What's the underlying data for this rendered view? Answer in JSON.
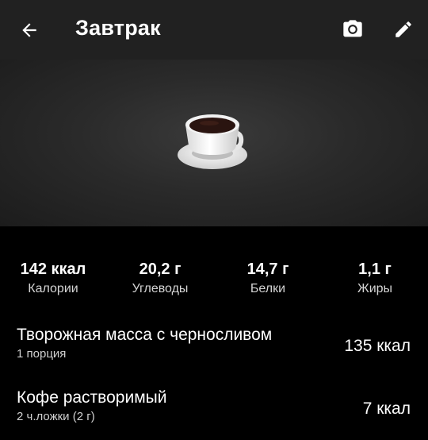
{
  "header": {
    "title": "Завтрак",
    "back_icon": "arrow-left-icon",
    "camera_icon": "camera-icon",
    "edit_icon": "pencil-icon"
  },
  "hero": {
    "image": "coffee-cup-icon"
  },
  "summary": [
    {
      "value": "142 ккал",
      "label": "Калории"
    },
    {
      "value": "20,2 г",
      "label": "Углеводы"
    },
    {
      "value": "14,7 г",
      "label": "Белки"
    },
    {
      "value": "1,1 г",
      "label": "Жиры"
    }
  ],
  "items": [
    {
      "name": "Творожная масса с черносливом",
      "portion": "1 порция",
      "kcal": "135 ккал"
    },
    {
      "name": "Кофе растворимый",
      "portion": "2 ч.ложки (2 г)",
      "kcal": "7 ккал"
    }
  ],
  "colors": {
    "app_bar": "#212121",
    "background": "#000000",
    "text": "#ffffff",
    "muted": "#d4d4d4"
  }
}
